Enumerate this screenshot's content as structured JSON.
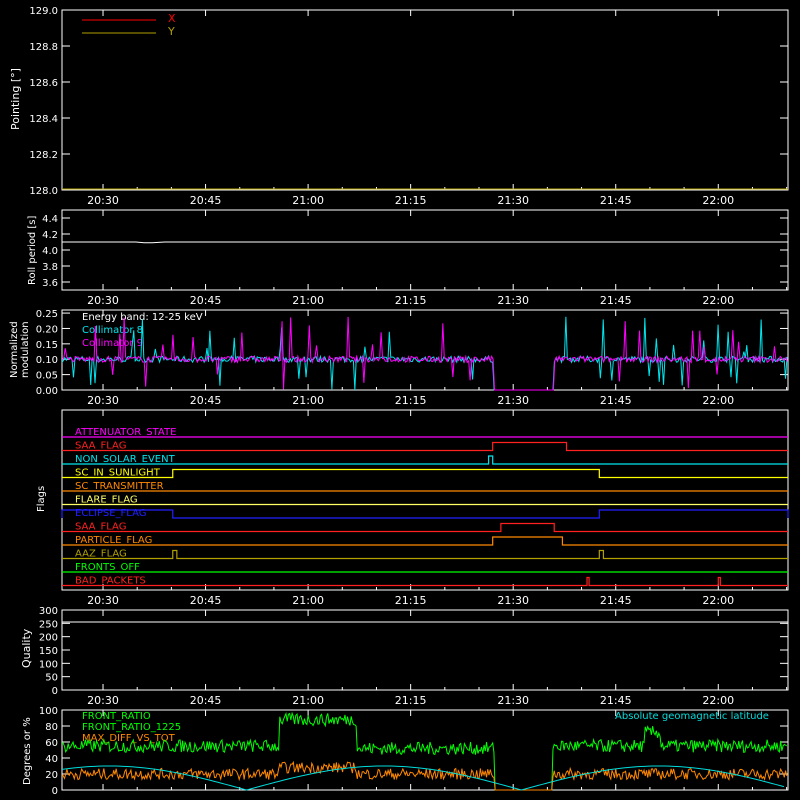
{
  "time_ticks": [
    "20:30",
    "20:45",
    "21:00",
    "21:15",
    "21:30",
    "21:45",
    "22:00"
  ],
  "colors": {
    "x": "#ff0000",
    "y": "#b0a000",
    "roll": "#ffffff",
    "c8": "#00e5ee",
    "c9": "#ff00ff",
    "front_ratio": "#00ff00",
    "front_ratio_1225": "#00ff00",
    "max_diff": "#ff8800",
    "geomag": "#00dddd"
  },
  "panel_pointing": {
    "ylabel": "Pointing [°]",
    "yticks": [
      "129.0",
      "128.8",
      "128.6",
      "128.4",
      "128.2",
      "128.0"
    ],
    "ylim": [
      128.0,
      129.0
    ],
    "legend": [
      "X",
      "Y"
    ]
  },
  "panel_roll": {
    "ylabel": "Roll period [s]",
    "yticks": [
      "4.4",
      "4.2",
      "4.0",
      "3.8",
      "3.6"
    ],
    "ylim": [
      3.5,
      4.5
    ]
  },
  "panel_modulation": {
    "ylabel_1": "Normalized",
    "ylabel_2": "modulation",
    "yticks": [
      "0.25",
      "0.20",
      "0.15",
      "0.10",
      "0.05",
      "0.00"
    ],
    "ylim": [
      0,
      0.26
    ],
    "legend": [
      "Energy band: 12-25 keV",
      "Collimator 8",
      "Collimator 9"
    ]
  },
  "panel_flags": {
    "ylabel": "Flags",
    "flags": [
      {
        "name": "ATTENUATOR_STATE",
        "color": "#ff00ff",
        "high": []
      },
      {
        "name": "SAA_FLAG",
        "color": "#ff2020",
        "high": [
          [
            21.45,
            21.63
          ]
        ]
      },
      {
        "name": "NON_SOLAR_EVENT",
        "color": "#00e5ee",
        "high": [
          [
            21.44,
            21.45
          ]
        ]
      },
      {
        "name": "SC_IN_SUNLIGHT",
        "color": "#ffff00",
        "high": [
          [
            20.67,
            21.71
          ]
        ]
      },
      {
        "name": "SC_TRANSMITTER",
        "color": "#ff8800",
        "high": []
      },
      {
        "name": "FLARE_FLAG",
        "color": "#ffff66",
        "high": []
      },
      {
        "name": "ECLIPSE_FLAG",
        "color": "#2020ff",
        "high": [
          [
            20.0,
            20.67
          ],
          [
            21.71,
            22.5
          ]
        ]
      },
      {
        "name": "SAA_FLAG",
        "color": "#ff2020",
        "high": [
          [
            21.47,
            21.6
          ]
        ]
      },
      {
        "name": "PARTICLE_FLAG",
        "color": "#ff8800",
        "high": [
          [
            21.45,
            21.62
          ]
        ]
      },
      {
        "name": "AAZ_FLAG",
        "color": "#b0a000",
        "high": [
          [
            20.67,
            20.68
          ],
          [
            21.71,
            21.72
          ]
        ]
      },
      {
        "name": "FRONTS_OFF",
        "color": "#00ff00",
        "high": []
      },
      {
        "name": "BAD_PACKETS",
        "color": "#ff2020",
        "high": [
          [
            21.68,
            21.685
          ],
          [
            22.0,
            22.005
          ]
        ]
      }
    ]
  },
  "panel_quality": {
    "ylabel": "Quality",
    "yticks": [
      "300",
      "250",
      "200",
      "150",
      "100",
      "50",
      "0"
    ],
    "ylim": [
      0,
      300
    ],
    "value": 0
  },
  "panel_ratio": {
    "ylabel": "Degrees or %",
    "yticks": [
      "100",
      "80",
      "60",
      "40",
      "20",
      "0"
    ],
    "ylim": [
      0,
      100
    ],
    "legend": [
      "FRONT_RATIO",
      "FRONT_RATIO_1225",
      "MAX_DIFF_VS_TOT"
    ],
    "legend_right": "Absolute geomagnetic latitude"
  },
  "chart_data": [
    {
      "type": "line",
      "x_range_hours": [
        20.4,
        22.17
      ],
      "x_ticks": [
        "20:30",
        "20:45",
        "21:00",
        "21:15",
        "21:30",
        "21:45",
        "22:00"
      ],
      "ylabel": "Pointing [°]",
      "ylim": [
        128.0,
        129.0
      ],
      "series": [
        {
          "name": "X",
          "x": [
            20.4,
            22.17
          ],
          "values": [
            128.0,
            128.0
          ]
        },
        {
          "name": "Y",
          "x": [
            20.4,
            22.17
          ],
          "values": [
            128.0,
            128.0
          ]
        }
      ]
    },
    {
      "type": "line",
      "ylabel": "Roll period [s]",
      "ylim": [
        3.5,
        4.5
      ],
      "series": [
        {
          "x": [
            20.4,
            20.58,
            20.6,
            20.62,
            20.65,
            22.17
          ],
          "values": [
            4.1,
            4.1,
            4.09,
            4.09,
            4.1,
            4.1
          ]
        }
      ]
    },
    {
      "type": "line",
      "ylabel": "Normalized modulation",
      "ylim": [
        0,
        0.26
      ],
      "series": [
        {
          "name": "Collimator 8",
          "typical": 0.1,
          "gap_hours": [
            21.45,
            21.6
          ]
        },
        {
          "name": "Collimator 9",
          "typical": 0.1,
          "gap_hours": [
            21.45,
            21.6
          ]
        }
      ]
    },
    {
      "type": "line",
      "ylabel": "Degrees or %",
      "ylim": [
        0,
        100
      ],
      "series": [
        {
          "name": "FRONT_RATIO",
          "x": [
            20.4,
            20.93,
            20.95,
            21.1,
            21.12,
            21.45,
            21.46,
            21.59,
            21.6,
            21.82,
            21.83,
            22.17
          ],
          "values": [
            55,
            55,
            90,
            90,
            55,
            55,
            0,
            0,
            50,
            50,
            60,
            55
          ]
        },
        {
          "name": "MAX_DIFF_VS_TOT",
          "x": [
            20.4,
            20.93,
            21.1,
            21.45,
            21.46,
            21.59,
            21.6,
            22.17
          ],
          "values": [
            20,
            25,
            30,
            20,
            0,
            0,
            20,
            25
          ]
        },
        {
          "name": "Absolute geomagnetic latitude",
          "x": [
            20.4,
            20.6,
            20.85,
            21.05,
            21.3,
            21.52,
            21.75,
            22.0,
            22.17
          ],
          "values": [
            18,
            10,
            2,
            30,
            18,
            2,
            25,
            30,
            28
          ]
        }
      ]
    }
  ]
}
